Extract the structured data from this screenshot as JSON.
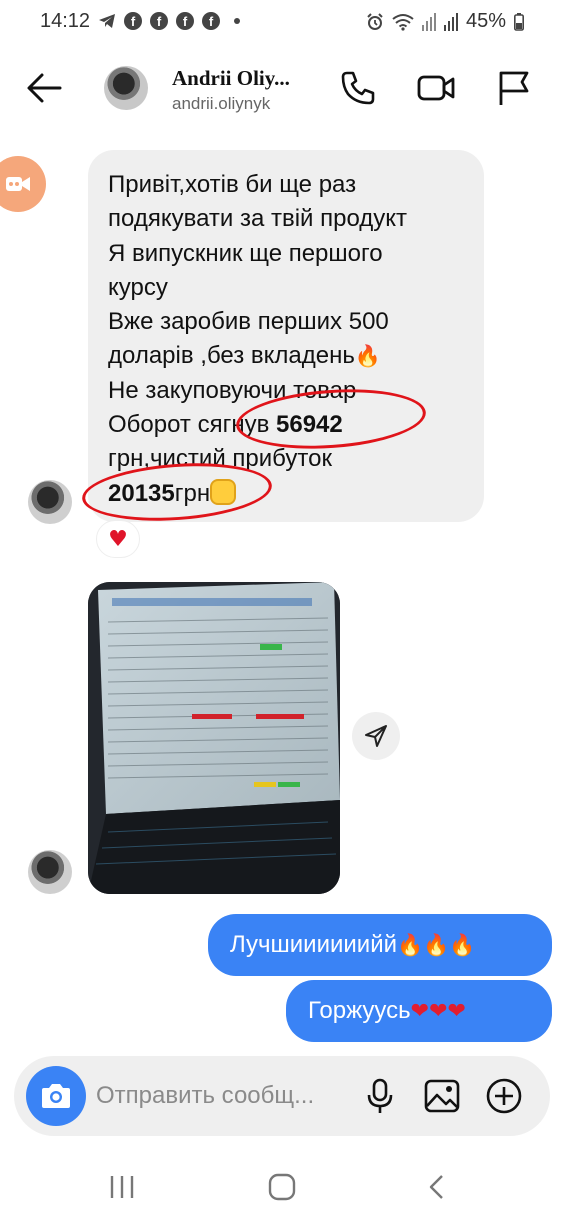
{
  "status_bar": {
    "time": "14:12",
    "battery": "45%",
    "left_icons": [
      "telegram-icon",
      "facebook-icon",
      "facebook-icon",
      "facebook-icon",
      "facebook-icon",
      "dot-icon"
    ],
    "right_icons": [
      "alarm-icon",
      "wifi-icon",
      "signal-icon",
      "signal-icon",
      "battery-icon"
    ]
  },
  "header": {
    "name": "Andrii Oliy...",
    "username": "andrii.oliynyk",
    "icons": [
      "back-arrow-icon",
      "phone-icon",
      "video-camera-icon",
      "flag-icon"
    ]
  },
  "messages": {
    "incoming_text": {
      "line1": "Привіт,хотів би ще раз",
      "line2": "подякувати за твій продукт",
      "line3": "Я випускник ще першого",
      "line4": "курсу",
      "line5": "Вже заробив перших 500",
      "line6_text": "доларів ,без вкладень",
      "line7": "Не закуповуючи товар",
      "line8_text": "Оборот сягнув ",
      "line8_bold": "56942",
      "line9": "грн,чистий прибуток",
      "line10_bold": "20135",
      "line10_text": "грн",
      "fire_emoji": "🔥",
      "reaction": "♥"
    },
    "incoming_photo": {
      "description_icon": "laptop-spreadsheet-photo"
    },
    "outgoing": [
      {
        "text": "Лучшиииииийй",
        "emoji": "🔥🔥🔥"
      },
      {
        "text": "Горжуусь",
        "emoji": "❤❤❤"
      }
    ]
  },
  "composer": {
    "placeholder": "Отправить сообщ...",
    "icons": [
      "camera-icon",
      "microphone-icon",
      "gallery-icon",
      "plus-circle-icon"
    ]
  },
  "nav_bar": {
    "icons": [
      "recent-apps-icon",
      "home-icon",
      "back-icon"
    ]
  },
  "colors": {
    "accent_blue": "#3a83f5",
    "bubble_gray": "#efefef",
    "annotation_red": "#e0141a",
    "video_chip": "#f5a77b"
  }
}
